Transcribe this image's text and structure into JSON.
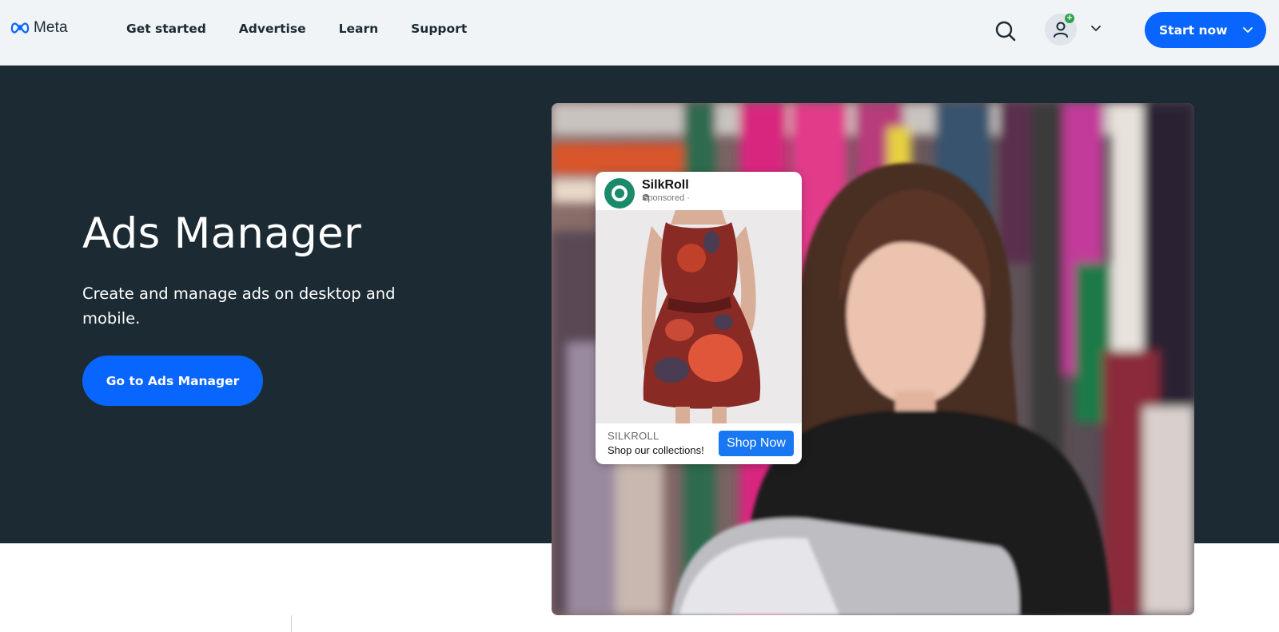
{
  "nav": {
    "brand": "Meta",
    "links": [
      "Get started",
      "Advertise",
      "Learn",
      "Support"
    ],
    "avatar_badge": "+",
    "start_label": "Start now"
  },
  "hero": {
    "title": "Ads Manager",
    "subtitle": "Create and manage ads on desktop and mobile.",
    "cta_label": "Go to Ads Manager"
  },
  "ad_card": {
    "brand": "SilkRoll",
    "sponsored": "Sponsored · ",
    "caps": "SILKROLL",
    "tagline": "Shop our collections!",
    "cta": "Shop Now"
  },
  "colors": {
    "accent": "#0866ff",
    "hero_bg": "#1c2b33",
    "nav_bg": "#f1f4f7",
    "ad_button": "#1877f2",
    "ad_logo": "#1a8a6b",
    "online_badge": "#31a24c"
  },
  "icons": {
    "logo": "meta-infinity-icon",
    "search": "search-icon",
    "account": "user-icon",
    "chevron": "chevron-down-icon",
    "globe": "globe-icon"
  }
}
